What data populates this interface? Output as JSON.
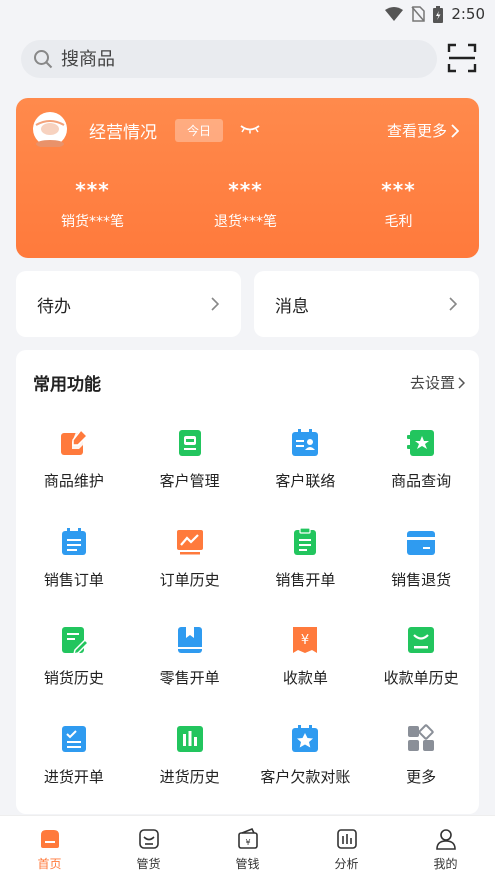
{
  "status_bar": {
    "time": "2:50"
  },
  "search": {
    "placeholder": "搜商品"
  },
  "business": {
    "title": "经营情况",
    "period_chip": "今日",
    "more_label": "查看更多",
    "stats": [
      {
        "value": "***",
        "label": "销货***笔"
      },
      {
        "value": "***",
        "label": "退货***笔"
      },
      {
        "value": "***",
        "label": "毛利"
      }
    ]
  },
  "todo": {
    "label": "待办"
  },
  "messages": {
    "label": "消息"
  },
  "functions": {
    "title": "常用功能",
    "settings_label": "去设置",
    "items": [
      {
        "label": "商品维护",
        "icon": "edit-product-icon",
        "color": "#ff7a3c"
      },
      {
        "label": "客户管理",
        "icon": "customer-manage-icon",
        "color": "#22c55e"
      },
      {
        "label": "客户联络",
        "icon": "customer-contact-icon",
        "color": "#2f9bf0"
      },
      {
        "label": "商品查询",
        "icon": "product-query-icon",
        "color": "#22c55e"
      },
      {
        "label": "销售订单",
        "icon": "sales-order-icon",
        "color": "#2f9bf0"
      },
      {
        "label": "订单历史",
        "icon": "order-history-icon",
        "color": "#ff7a3c"
      },
      {
        "label": "销售开单",
        "icon": "sales-billing-icon",
        "color": "#22c55e"
      },
      {
        "label": "销售退货",
        "icon": "sales-return-icon",
        "color": "#2f9bf0"
      },
      {
        "label": "销货历史",
        "icon": "sales-history-icon",
        "color": "#22c55e"
      },
      {
        "label": "零售开单",
        "icon": "retail-billing-icon",
        "color": "#2f9bf0"
      },
      {
        "label": "收款单",
        "icon": "receipt-icon",
        "color": "#ff7a3c"
      },
      {
        "label": "收款单历史",
        "icon": "receipt-history-icon",
        "color": "#22c55e"
      },
      {
        "label": "进货开单",
        "icon": "purchase-billing-icon",
        "color": "#2f9bf0"
      },
      {
        "label": "进货历史",
        "icon": "purchase-history-icon",
        "color": "#22c55e"
      },
      {
        "label": "客户欠款对账",
        "icon": "customer-debt-icon",
        "color": "#2f9bf0"
      },
      {
        "label": "更多",
        "icon": "more-grid-icon",
        "color": "#8a8f98"
      }
    ]
  },
  "tabbar": {
    "items": [
      {
        "label": "首页",
        "icon": "home-icon",
        "active": true
      },
      {
        "label": "管货",
        "icon": "goods-icon",
        "active": false
      },
      {
        "label": "管钱",
        "icon": "wallet-icon",
        "active": false
      },
      {
        "label": "分析",
        "icon": "chart-icon",
        "active": false
      },
      {
        "label": "我的",
        "icon": "user-icon",
        "active": false
      }
    ],
    "active_color": "#ff7a3c"
  }
}
